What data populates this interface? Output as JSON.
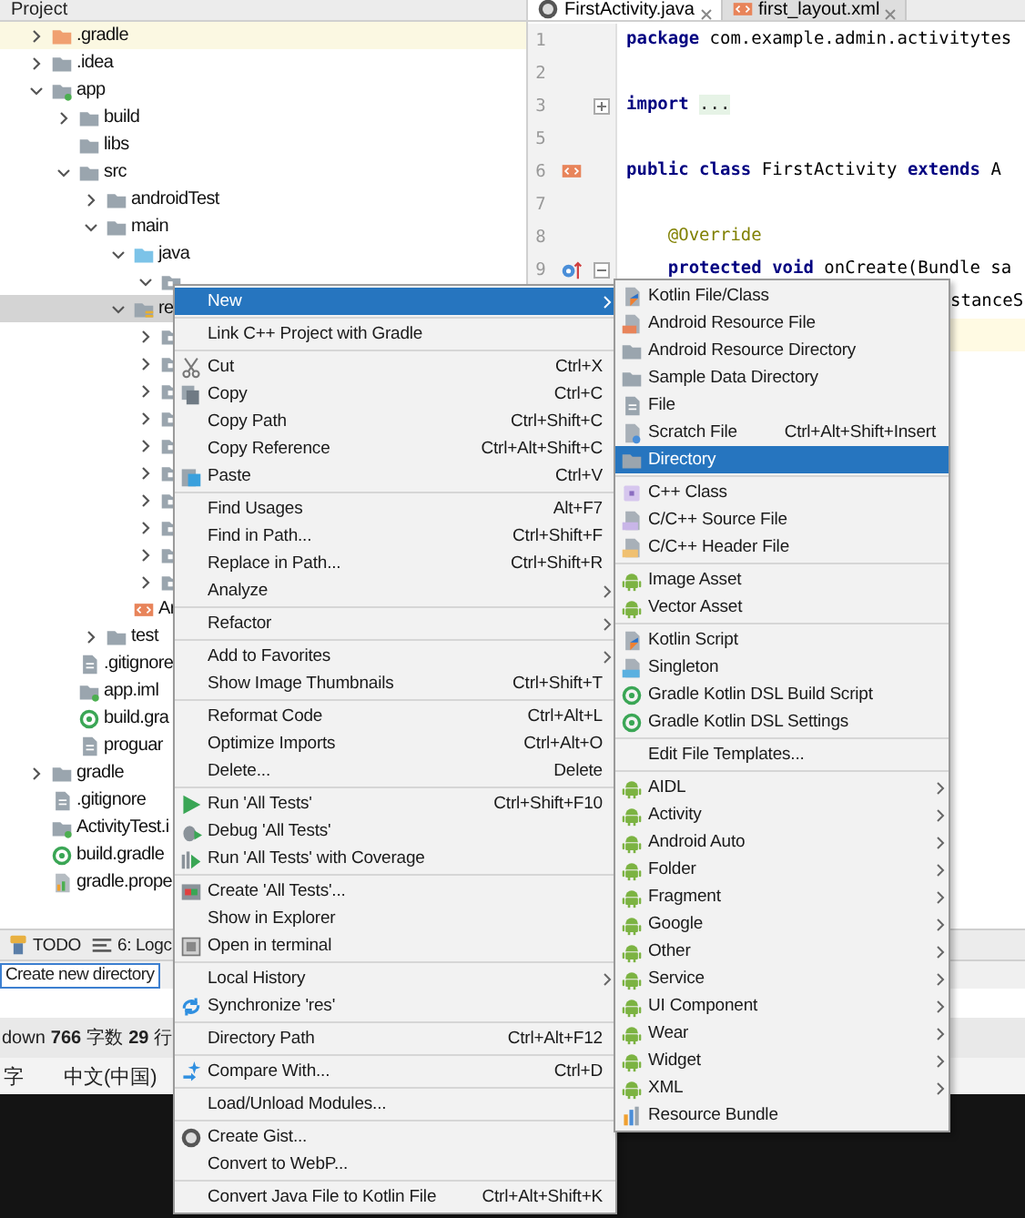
{
  "project": {
    "title": "Project",
    "tree": [
      {
        "label": ".gradle",
        "kind": "folder-orange",
        "expanded": false,
        "selected": false,
        "highlighted": true
      },
      {
        "label": ".idea",
        "kind": "folder",
        "expanded": false,
        "selected": false,
        "highlighted": false
      },
      {
        "label": "app",
        "kind": "module",
        "expanded": true,
        "selected": false,
        "highlighted": false,
        "children": [
          {
            "label": "build",
            "kind": "folder",
            "expanded": false,
            "selected": false,
            "highlighted": false
          },
          {
            "label": "libs",
            "kind": "folder",
            "selected": false,
            "highlighted": false
          },
          {
            "label": "src",
            "kind": "folder",
            "expanded": true,
            "selected": false,
            "highlighted": false,
            "children": [
              {
                "label": "androidTest",
                "kind": "folder",
                "expanded": false,
                "selected": false,
                "highlighted": false
              },
              {
                "label": "main",
                "kind": "folder",
                "expanded": true,
                "selected": false,
                "highlighted": false,
                "children": [
                  {
                    "label": "java",
                    "kind": "folder-source",
                    "expanded": true,
                    "selected": false,
                    "highlighted": false,
                    "children": [
                      {
                        "kind": "package",
                        "expanded": true,
                        "selected": false,
                        "highlighted": false
                      }
                    ]
                  },
                  {
                    "label": "re",
                    "kind": "folder-res",
                    "expanded": true,
                    "selected": true,
                    "highlighted": false,
                    "children": [
                      {
                        "kind": "package",
                        "expanded": false,
                        "selected": false,
                        "highlighted": false
                      },
                      {
                        "kind": "package",
                        "expanded": false,
                        "selected": false,
                        "highlighted": false
                      },
                      {
                        "kind": "package",
                        "expanded": false,
                        "selected": false,
                        "highlighted": false
                      },
                      {
                        "kind": "package",
                        "expanded": false,
                        "selected": false,
                        "highlighted": false
                      },
                      {
                        "kind": "package",
                        "expanded": false,
                        "selected": false,
                        "highlighted": false
                      },
                      {
                        "kind": "package",
                        "expanded": false,
                        "selected": false,
                        "highlighted": false
                      },
                      {
                        "kind": "package",
                        "expanded": false,
                        "selected": false,
                        "highlighted": false
                      },
                      {
                        "kind": "package",
                        "expanded": false,
                        "selected": false,
                        "highlighted": false
                      },
                      {
                        "kind": "package",
                        "expanded": false,
                        "selected": false,
                        "highlighted": false
                      },
                      {
                        "kind": "package",
                        "expanded": false,
                        "selected": false,
                        "highlighted": false
                      }
                    ]
                  },
                  {
                    "label": "Ar",
                    "kind": "manifest",
                    "selected": false,
                    "highlighted": false
                  }
                ]
              },
              {
                "label": "test",
                "kind": "folder",
                "expanded": false,
                "selected": false,
                "highlighted": false
              }
            ]
          },
          {
            "label": ".gitignore",
            "kind": "file",
            "selected": false,
            "highlighted": false
          },
          {
            "label": "app.iml",
            "kind": "module",
            "selected": false,
            "highlighted": false
          },
          {
            "label": "build.gra",
            "kind": "gradle",
            "selected": false,
            "highlighted": false
          },
          {
            "label": "proguar",
            "kind": "file",
            "selected": false,
            "highlighted": false
          }
        ]
      },
      {
        "label": "gradle",
        "kind": "folder",
        "expanded": false,
        "selected": false,
        "highlighted": false
      },
      {
        "label": ".gitignore",
        "kind": "file",
        "selected": false,
        "highlighted": false
      },
      {
        "label": "ActivityTest.i",
        "kind": "module",
        "selected": false,
        "highlighted": false
      },
      {
        "label": "build.gradle",
        "kind": "gradle",
        "selected": false,
        "highlighted": false
      },
      {
        "label": "gradle.prope",
        "kind": "properties",
        "selected": false,
        "highlighted": false
      }
    ]
  },
  "editor": {
    "tabs": [
      {
        "label": "FirstActivity.java",
        "selected": true
      },
      {
        "label": "first_layout.xml",
        "selected": false
      }
    ],
    "lines": [
      {
        "number": "1",
        "current": false,
        "parts": [
          {
            "kind": "keyword",
            "text": "package"
          },
          {
            "kind": "plain",
            "text": " com.example.admin.activitytes"
          }
        ]
      },
      {
        "number": "2",
        "current": false
      },
      {
        "number": "3",
        "current": false,
        "fold": {
          "collapsed": true
        },
        "parts": [
          {
            "kind": "keyword",
            "text": "import"
          },
          {
            "kind": "folded",
            "text": "..."
          }
        ]
      },
      {
        "number": "5",
        "current": false
      },
      {
        "number": "6",
        "current": false,
        "gutter_icon": {
          "kind": "layout"
        },
        "parts": [
          {
            "kind": "keyword",
            "text": "public class"
          },
          {
            "kind": "plain",
            "text": " FirstActivity "
          },
          {
            "kind": "keyword",
            "text": "extends"
          },
          {
            "kind": "plain",
            "text": " A"
          }
        ]
      },
      {
        "number": "7",
        "current": false
      },
      {
        "number": "8",
        "current": false,
        "parts": [
          {
            "kind": "annotation",
            "text": "    @Override"
          }
        ]
      },
      {
        "number": "9",
        "current": false,
        "gutter_icon": {
          "kind": "override"
        },
        "fold": {
          "collapsed": false
        },
        "parts": [
          {
            "kind": "keyword",
            "text": "    protected void"
          },
          {
            "kind": "plain",
            "text": " onCreate(Bundle sa"
          }
        ]
      },
      {
        "current": false,
        "parts": [
          {
            "kind": "plain",
            "text": "stanceS"
          }
        ]
      },
      {
        "current": true
      }
    ]
  },
  "tool_strip": [
    {
      "label": "TODO",
      "kind": "todo"
    },
    {
      "label": "6: Logc",
      "kind": "logcat"
    }
  ],
  "status_bar": {
    "text": "Create new directory"
  },
  "background_window": {
    "stats": [
      {
        "kind": "label",
        "text": "down"
      },
      {
        "kind": "value",
        "text": "766"
      },
      {
        "kind": "label",
        "text": "字数"
      },
      {
        "kind": "value",
        "text": "29"
      },
      {
        "kind": "label",
        "text": "行"
      }
    ],
    "language": [
      "字",
      "中文(中国)"
    ]
  },
  "context_menu": {
    "groups": [
      [
        {
          "label": "New",
          "submenu": true,
          "selected": true
        }
      ],
      [
        {
          "label": "Link C++ Project with Gradle",
          "selected": false
        }
      ],
      [
        {
          "label": "Cut",
          "shortcut": "Ctrl+X",
          "kind": "cut",
          "selected": false
        },
        {
          "label": "Copy",
          "shortcut": "Ctrl+C",
          "kind": "copy",
          "selected": false
        },
        {
          "label": "Copy Path",
          "shortcut": "Ctrl+Shift+C",
          "selected": false
        },
        {
          "label": "Copy Reference",
          "shortcut": "Ctrl+Alt+Shift+C",
          "selected": false
        },
        {
          "label": "Paste",
          "shortcut": "Ctrl+V",
          "kind": "paste",
          "selected": false
        }
      ],
      [
        {
          "label": "Find Usages",
          "shortcut": "Alt+F7",
          "selected": false
        },
        {
          "label": "Find in Path...",
          "shortcut": "Ctrl+Shift+F",
          "selected": false
        },
        {
          "label": "Replace in Path...",
          "shortcut": "Ctrl+Shift+R",
          "selected": false
        },
        {
          "label": "Analyze",
          "submenu": true,
          "selected": false
        }
      ],
      [
        {
          "label": "Refactor",
          "submenu": true,
          "selected": false
        }
      ],
      [
        {
          "label": "Add to Favorites",
          "submenu": true,
          "selected": false
        },
        {
          "label": "Show Image Thumbnails",
          "shortcut": "Ctrl+Shift+T",
          "selected": false
        }
      ],
      [
        {
          "label": "Reformat Code",
          "shortcut": "Ctrl+Alt+L",
          "selected": false
        },
        {
          "label": "Optimize Imports",
          "shortcut": "Ctrl+Alt+O",
          "selected": false
        },
        {
          "label": "Delete...",
          "shortcut": "Delete",
          "selected": false
        }
      ],
      [
        {
          "label": "Run 'All Tests'",
          "shortcut": "Ctrl+Shift+F10",
          "kind": "run",
          "selected": false
        },
        {
          "label": "Debug 'All Tests'",
          "kind": "debug",
          "selected": false
        },
        {
          "label": "Run 'All Tests' with Coverage",
          "kind": "coverage",
          "selected": false
        }
      ],
      [
        {
          "label": "Create 'All Tests'...",
          "kind": "test",
          "selected": false
        },
        {
          "label": "Show in Explorer",
          "selected": false
        },
        {
          "label": "Open in terminal",
          "kind": "terminal",
          "selected": false
        }
      ],
      [
        {
          "label": "Local History",
          "submenu": true,
          "selected": false
        },
        {
          "label": "Synchronize 'res'",
          "kind": "sync",
          "selected": false
        }
      ],
      [
        {
          "label": "Directory Path",
          "shortcut": "Ctrl+Alt+F12",
          "selected": false
        }
      ],
      [
        {
          "label": "Compare With...",
          "shortcut": "Ctrl+D",
          "kind": "compare",
          "selected": false
        }
      ],
      [
        {
          "label": "Load/Unload Modules...",
          "selected": false
        }
      ],
      [
        {
          "label": "Create Gist...",
          "kind": "gist",
          "selected": false
        },
        {
          "label": "Convert to WebP...",
          "selected": false
        }
      ],
      [
        {
          "label": "Convert Java File to Kotlin File",
          "shortcut": "Ctrl+Alt+Shift+K",
          "selected": false
        }
      ]
    ]
  },
  "new_submenu": {
    "groups": [
      [
        {
          "label": "Kotlin File/Class",
          "kind": "kotlin",
          "selected": false
        },
        {
          "label": "Android Resource File",
          "kind": "resource-file",
          "selected": false
        },
        {
          "label": "Android Resource Directory",
          "kind": "folder",
          "selected": false
        },
        {
          "label": "Sample Data Directory",
          "kind": "folder",
          "selected": false
        },
        {
          "label": "File",
          "kind": "file",
          "selected": false
        },
        {
          "label": "Scratch File",
          "shortcut": "Ctrl+Alt+Shift+Insert",
          "kind": "scratch",
          "selected": false
        },
        {
          "label": "Directory",
          "kind": "folder",
          "selected": true
        }
      ],
      [
        {
          "label": "C++ Class",
          "kind": "cpp-class",
          "selected": false
        },
        {
          "label": "C/C++ Source File",
          "kind": "cpp-source",
          "selected": false
        },
        {
          "label": "C/C++ Header File",
          "kind": "cpp-header",
          "selected": false
        }
      ],
      [
        {
          "label": "Image Asset",
          "kind": "android",
          "selected": false
        },
        {
          "label": "Vector Asset",
          "kind": "android",
          "selected": false
        }
      ],
      [
        {
          "label": "Kotlin Script",
          "kind": "kotlin",
          "selected": false
        },
        {
          "label": "Singleton",
          "kind": "singleton",
          "selected": false
        },
        {
          "label": "Gradle Kotlin DSL Build Script",
          "kind": "gradle",
          "selected": false
        },
        {
          "label": "Gradle Kotlin DSL Settings",
          "kind": "gradle",
          "selected": false
        }
      ],
      [
        {
          "label": "Edit File Templates...",
          "selected": false
        }
      ],
      [
        {
          "label": "AIDL",
          "kind": "android",
          "submenu": true,
          "selected": false
        },
        {
          "label": "Activity",
          "kind": "android",
          "submenu": true,
          "selected": false
        },
        {
          "label": "Android Auto",
          "kind": "android",
          "submenu": true,
          "selected": false
        },
        {
          "label": "Folder",
          "kind": "android",
          "submenu": true,
          "selected": false
        },
        {
          "label": "Fragment",
          "kind": "android",
          "submenu": true,
          "selected": false
        },
        {
          "label": "Google",
          "kind": "android",
          "submenu": true,
          "selected": false
        },
        {
          "label": "Other",
          "kind": "android",
          "submenu": true,
          "selected": false
        },
        {
          "label": "Service",
          "kind": "android",
          "submenu": true,
          "selected": false
        },
        {
          "label": "UI Component",
          "kind": "android",
          "submenu": true,
          "selected": false
        },
        {
          "label": "Wear",
          "kind": "android",
          "submenu": true,
          "selected": false
        },
        {
          "label": "Widget",
          "kind": "android",
          "submenu": true,
          "selected": false
        },
        {
          "label": "XML",
          "kind": "android",
          "submenu": true,
          "selected": false
        },
        {
          "label": "Resource Bundle",
          "kind": "bundle",
          "selected": false
        }
      ]
    ]
  }
}
